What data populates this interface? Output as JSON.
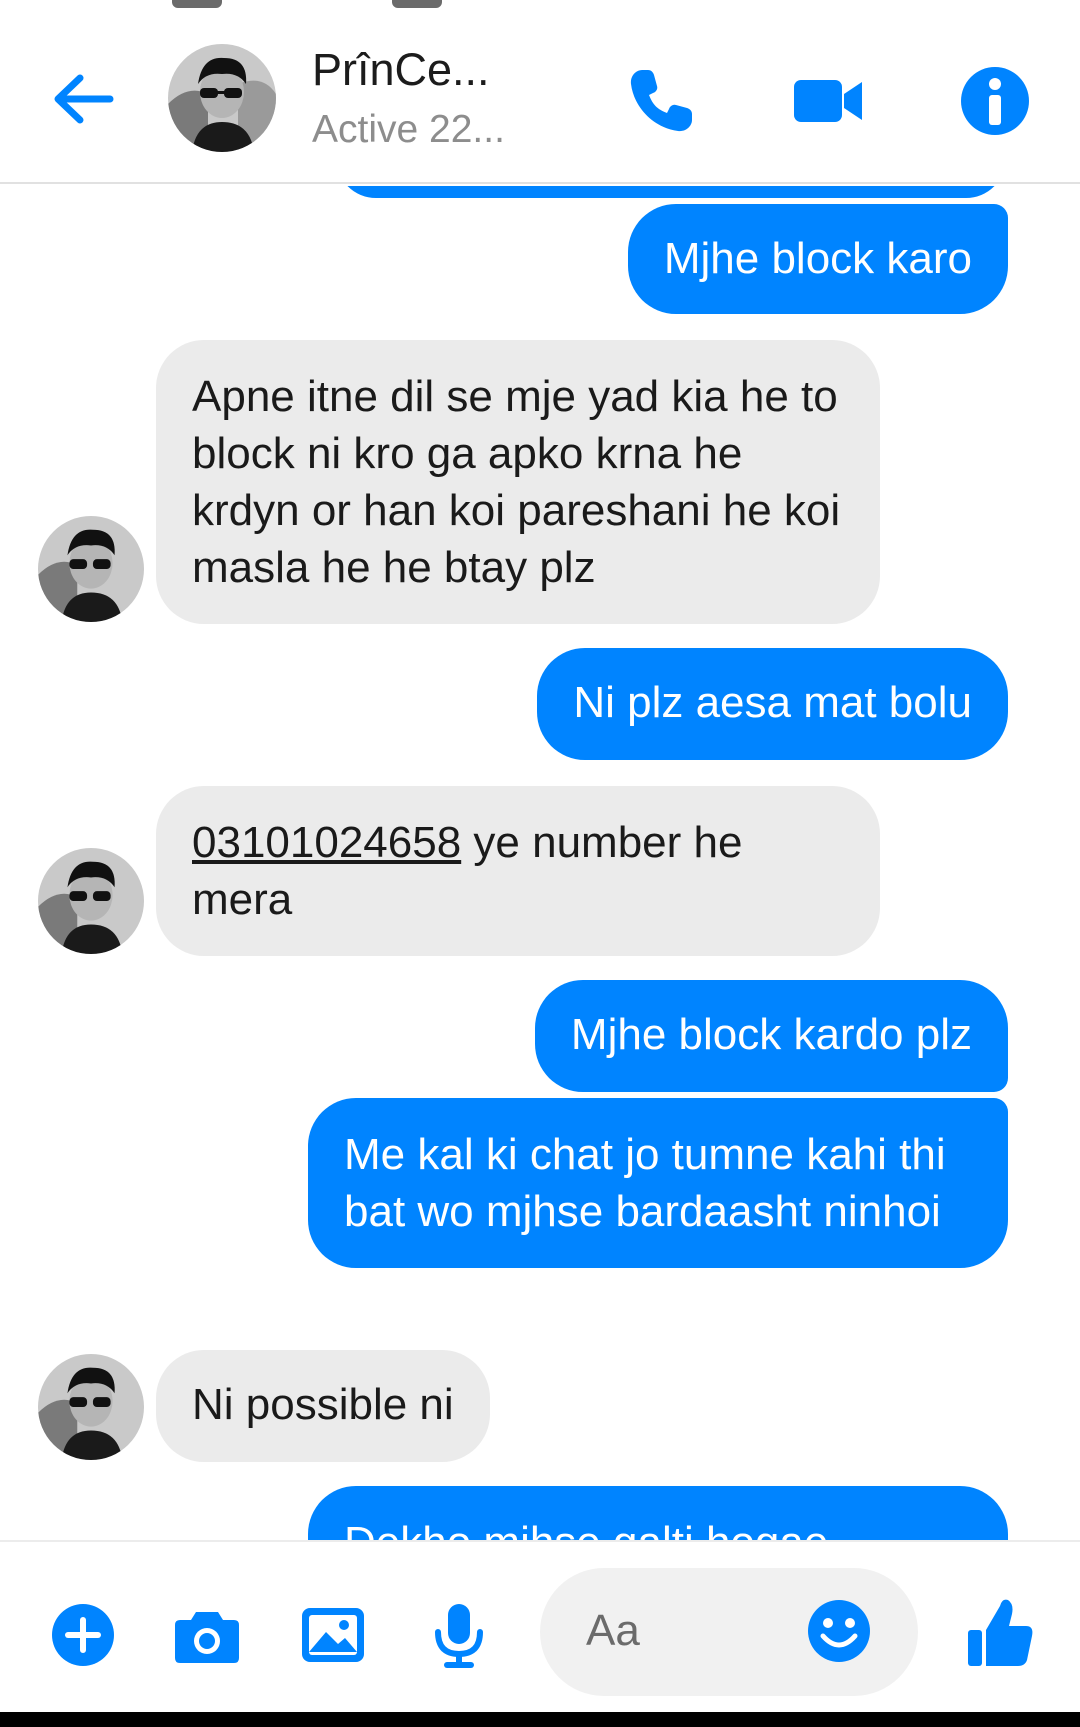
{
  "header": {
    "contact_name": "PrînCe...",
    "contact_status": "Active 22...",
    "back_icon": "arrow-left",
    "call_icon": "phone",
    "video_icon": "video-camera",
    "info_icon": "info"
  },
  "messages": [
    {
      "direction": "outgoing",
      "text": "Mjhe block karo"
    },
    {
      "direction": "incoming",
      "text": "Apne itne dil se mje yad kia he to block ni kro ga apko krna he krdyn or han koi pareshani he koi masla he he btay plz"
    },
    {
      "direction": "outgoing",
      "text": "Ni plz aesa mat bolu"
    },
    {
      "direction": "incoming",
      "phone": "03101024658",
      "text": " ye number he mera"
    },
    {
      "direction": "outgoing",
      "text": "Mjhe block kardo plz"
    },
    {
      "direction": "outgoing",
      "text": "Me kal ki chat jo tumne kahi thi bat wo mjhse bardaasht ninhoi"
    },
    {
      "direction": "incoming",
      "text": "Ni possible ni"
    },
    {
      "direction": "outgoing",
      "text": "Dekho mjhse galti hogae"
    }
  ],
  "composer": {
    "placeholder": "Aa",
    "icons": [
      "plus-circle",
      "camera",
      "image",
      "microphone",
      "smiley",
      "thumbs-up"
    ]
  },
  "colors": {
    "accent": "#0084ff",
    "incoming_bubble": "#ebebeb",
    "muted_text": "#8d8d8d"
  }
}
